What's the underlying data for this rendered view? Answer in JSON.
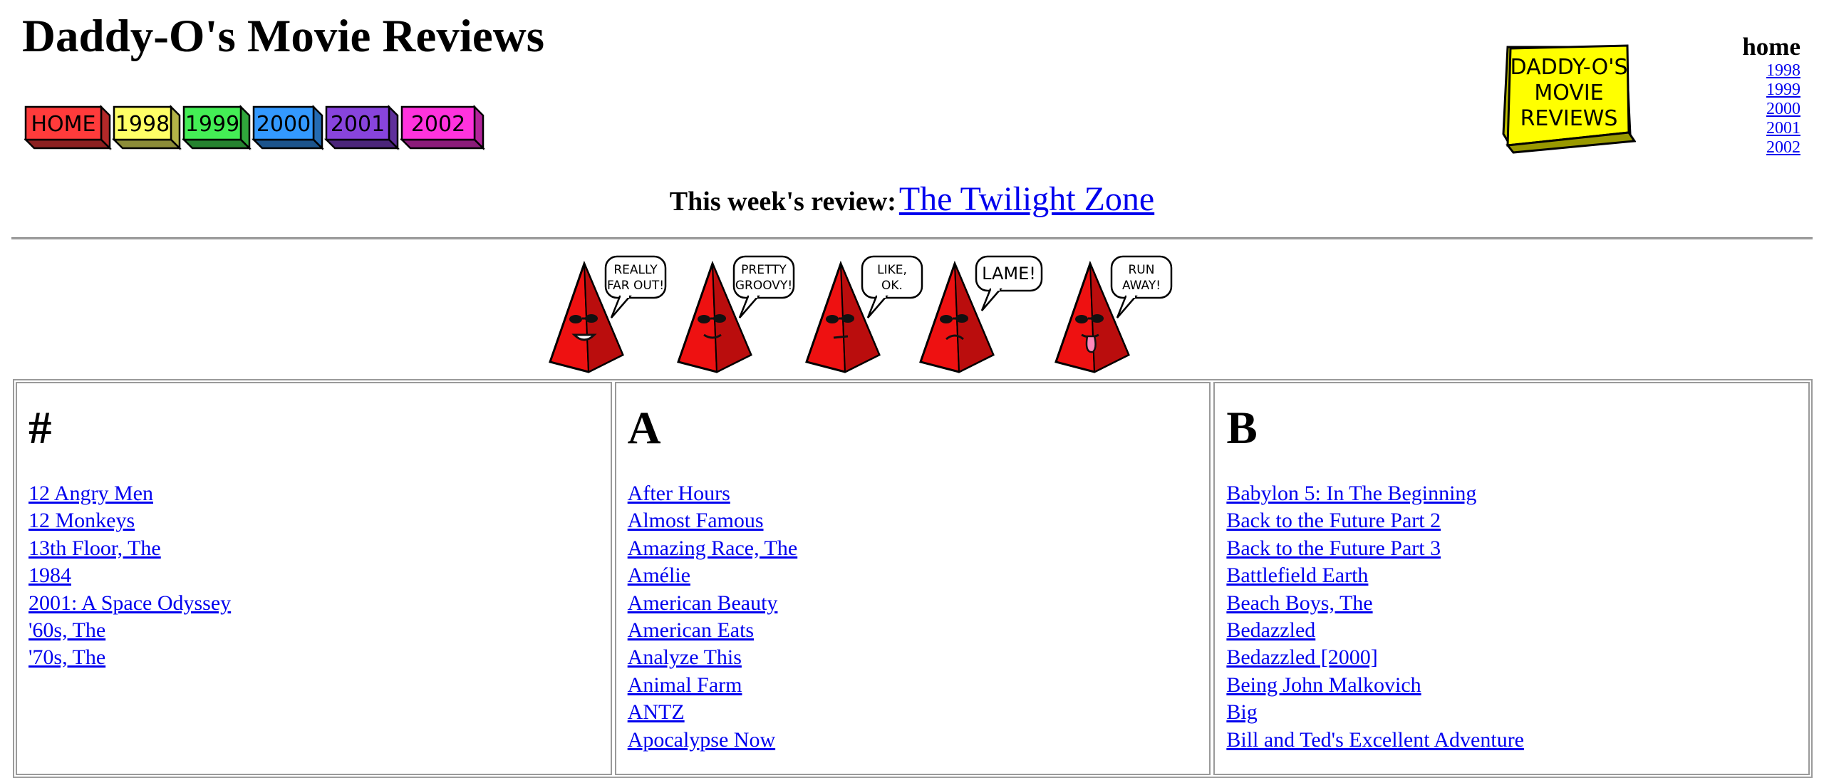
{
  "site_title": "Daddy-O's Movie Reviews",
  "nav_buttons": [
    {
      "label": "HOME",
      "color": "#ff3b3b"
    },
    {
      "label": "1998",
      "color": "#ffff66"
    },
    {
      "label": "1999",
      "color": "#44ee55"
    },
    {
      "label": "2000",
      "color": "#3399ff"
    },
    {
      "label": "2001",
      "color": "#8844dd"
    },
    {
      "label": "2002",
      "color": "#ff33dd"
    }
  ],
  "logo": {
    "lines": [
      "DADDY-O'S",
      "MOVIE",
      "REVIEWS"
    ],
    "color": "#ffff00"
  },
  "side_nav": {
    "home": "home",
    "years": [
      "1998",
      "1999",
      "2000",
      "2001",
      "2002"
    ]
  },
  "review": {
    "label": "This week's review:",
    "title": "The Twilight Zone"
  },
  "rating_scale": [
    {
      "caption": [
        "REALLY",
        "FAR OUT!"
      ],
      "mood": "grin"
    },
    {
      "caption": [
        "PRETTY",
        "GROOVY!"
      ],
      "mood": "smile"
    },
    {
      "caption": [
        "LIKE,",
        "OK."
      ],
      "mood": "flat"
    },
    {
      "caption": [
        "LAME!"
      ],
      "mood": "frown"
    },
    {
      "caption": [
        "RUN",
        "AWAY!"
      ],
      "mood": "tongue"
    }
  ],
  "colors": {
    "pyramid": "#ee1111",
    "link": "#0000ee"
  },
  "columns": [
    {
      "letter": "#",
      "titles": [
        "12 Angry Men",
        "12 Monkeys",
        "13th Floor, The",
        "1984",
        "2001: A Space Odyssey",
        "'60s, The",
        "'70s, The"
      ]
    },
    {
      "letter": "A",
      "titles": [
        "After Hours",
        "Almost Famous",
        "Amazing Race, The",
        "Amélie",
        "American Beauty",
        "American Eats",
        "Analyze This",
        "Animal Farm",
        "ANTZ",
        "Apocalypse Now"
      ]
    },
    {
      "letter": "B",
      "titles": [
        "Babylon 5: In The Beginning",
        "Back to the Future Part 2",
        "Back to the Future Part 3",
        "Battlefield Earth",
        "Beach Boys, The",
        "Bedazzled",
        "Bedazzled [2000]",
        "Being John Malkovich",
        "Big",
        "Bill and Ted's Excellent Adventure"
      ]
    }
  ]
}
